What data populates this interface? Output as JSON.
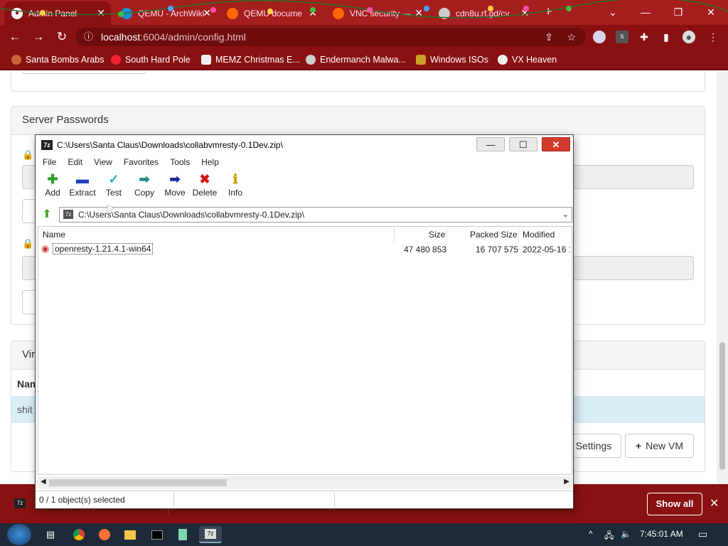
{
  "browser": {
    "tabs": [
      {
        "title": "Admin Panel",
        "active": true
      },
      {
        "title": "QEMU - ArchWiki"
      },
      {
        "title": "QEMU docume"
      },
      {
        "title": "VNC security —"
      },
      {
        "title": "cdn8u.rf.gd/cv"
      }
    ],
    "url_host": "localhost",
    "url_path": ":6004/admin/config.html",
    "bookmarks": [
      "Santa Bombs Arabs",
      "South Hard Pole",
      "MEMZ Christmas E...",
      "Endermanch Malwa...",
      "Windows ISOs",
      "VX Heaven"
    ]
  },
  "page": {
    "passwords_title": "Server Passwords",
    "vm_panel_prefix": "Vir",
    "table_name_prefix": "Nam",
    "row_prefix": "shit",
    "settings_label": "Settings",
    "new_vm_label": "New VM"
  },
  "download_bar": {
    "show_all": "Show all"
  },
  "taskbar": {
    "time": "7:45:01 AM"
  },
  "zip": {
    "title": "C:\\Users\\Santa Claus\\Downloads\\collabvmresty-0.1Dev.zip\\",
    "menu": [
      "File",
      "Edit",
      "View",
      "Favorites",
      "Tools",
      "Help"
    ],
    "toolbar": [
      "Add",
      "Extract",
      "Test",
      "Copy",
      "Move",
      "Delete",
      "Info"
    ],
    "address": "C:\\Users\\Santa Claus\\Downloads\\collabvmresty-0.1Dev.zip\\",
    "columns": [
      "Name",
      "Size",
      "Packed Size",
      "Modified"
    ],
    "rows": [
      {
        "name": "openresty-1.21.4.1-win64",
        "size": "47 480 853",
        "packed": "16 707 575",
        "modified": "2022-05-16 1"
      }
    ],
    "status": "0 / 1 object(s) selected"
  },
  "colors": {
    "chrome_theme": "#8a1111",
    "tab_strip": "#a51e1e"
  }
}
